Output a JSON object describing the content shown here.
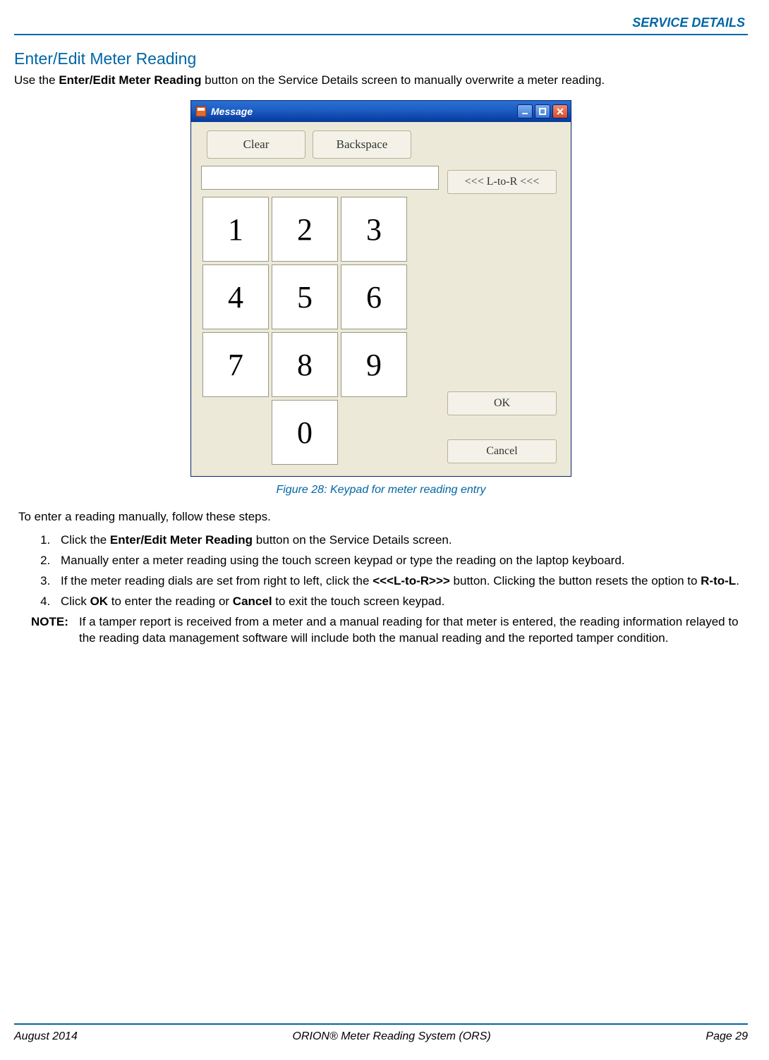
{
  "header": {
    "section": "SERVICE DETAILS"
  },
  "section": {
    "title": "Enter/Edit Meter Reading",
    "intro_pre": "Use the ",
    "intro_bold": "Enter/Edit Meter Reading",
    "intro_post": " button on the Service Details screen to manually overwrite a meter reading."
  },
  "window": {
    "title": "Message",
    "clear": "Clear",
    "backspace": "Backspace",
    "ltor": "<<< L-to-R <<<",
    "ok": "OK",
    "cancel": "Cancel",
    "keys": {
      "1": "1",
      "2": "2",
      "3": "3",
      "4": "4",
      "5": "5",
      "6": "6",
      "7": "7",
      "8": "8",
      "9": "9",
      "0": "0"
    }
  },
  "figure_caption": "Figure 28:  Keypad for meter reading entry",
  "steps_intro": "To enter a reading manually, follow these steps.",
  "steps": {
    "s1_a": "Click the ",
    "s1_b": "Enter/Edit Meter Reading",
    "s1_c": " button on the Service Details screen.",
    "s2": "Manually enter a meter reading using the touch screen keypad or type the reading on the laptop keyboard.",
    "s3_a": "If the meter reading dials are set from right to left, click the ",
    "s3_b": "<<<L-to-R>>>",
    "s3_c": " button. Clicking the button resets the option to ",
    "s3_d": "R-to-L",
    "s3_e": ".",
    "s4_a": "Click ",
    "s4_b": "OK",
    "s4_c": " to enter the reading or ",
    "s4_d": "Cancel",
    "s4_e": " to exit the touch screen keypad."
  },
  "note": {
    "label": "NOTE:",
    "text": "If a tamper report is received from a meter and a manual reading for that meter is entered, the reading information relayed to the reading data management software will include both the manual reading and the reported tamper condition."
  },
  "footer": {
    "left": "August 2014",
    "center": "ORION® Meter Reading System (ORS)",
    "right": "Page 29"
  }
}
